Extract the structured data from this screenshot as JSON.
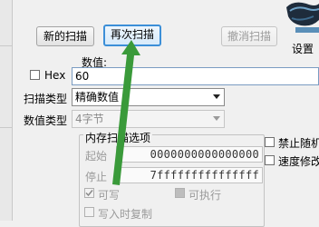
{
  "toolbar": {
    "new_scan": "新的扫描",
    "next_scan": "再次扫描",
    "undo_scan": "撤消扫描",
    "settings": "设置"
  },
  "value": {
    "label": "数值:",
    "hex_label": "Hex",
    "input_value": "60"
  },
  "scan_type": {
    "label": "扫描类型",
    "selected": "精确数值"
  },
  "value_type": {
    "label": "数值类型",
    "selected": "4字节"
  },
  "memory_options": {
    "title": "内存扫描选项",
    "start_label": "起始",
    "start_value": "0000000000000000",
    "stop_label": "停止",
    "stop_value": "7fffffffffffffff",
    "writable_label": "可写",
    "executable_label": "可执行",
    "copy_on_write_label": "写入时复制"
  },
  "right_options": {
    "random_label": "禁止随机",
    "speed_label": "速度修改"
  },
  "colors": {
    "arrow": "#3a9a3a",
    "active_button_border": "#3c8fd8"
  }
}
